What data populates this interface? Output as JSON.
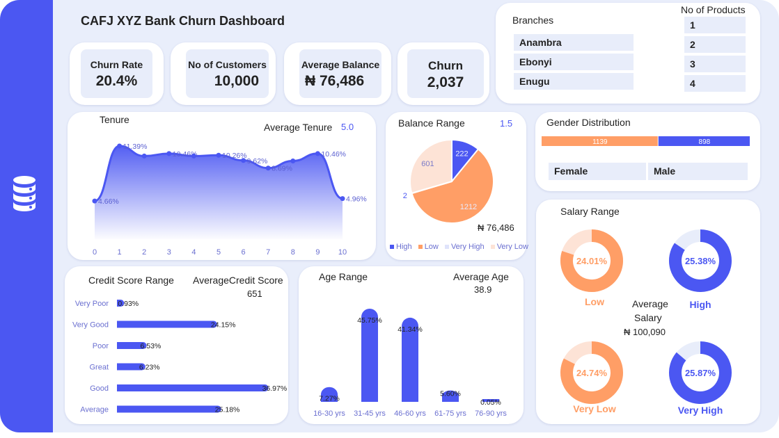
{
  "dashboard": {
    "title": "CAFJ XYZ Bank Churn Dashboard"
  },
  "kpis": [
    {
      "label": "Churn Rate",
      "value": "20.4%"
    },
    {
      "label": "No of Customers",
      "value": "10,000"
    },
    {
      "label": "Average Balance",
      "value": "₦ 76,486"
    },
    {
      "label": "Churn",
      "value": "2,037"
    }
  ],
  "branches": {
    "title": "Branches",
    "items": [
      "Anambra",
      "Ebonyi",
      "Enugu"
    ]
  },
  "products": {
    "title": "No of Products",
    "items": [
      "1",
      "2",
      "3",
      "4"
    ]
  },
  "tenure": {
    "title": "Tenure",
    "avg_label": "Average Tenure",
    "avg_value": "5.0"
  },
  "balance_range": {
    "title": "Balance Range",
    "value_note": "1.5",
    "avg_value": "₦ 76,486"
  },
  "gender": {
    "title": "Gender Distribution",
    "female_label": "Female",
    "male_label": "Male"
  },
  "credit": {
    "title": "Credit Score Range",
    "avg_label": "AverageCredit Score",
    "avg_value": "651"
  },
  "age": {
    "title": "Age Range",
    "avg_label": "Average Age",
    "avg_value": "38.9"
  },
  "salary": {
    "title": "Salary Range",
    "avg_label_1": "Average",
    "avg_label_2": "Salary",
    "avg_value": "₦ 100,090",
    "rings": [
      {
        "label": "Low",
        "value": 24.01,
        "text": "24.01%",
        "color": "#ff9e66"
      },
      {
        "label": "High",
        "value": 25.38,
        "text": "25.38%",
        "color": "#4b57f2"
      },
      {
        "label": "Very Low",
        "value": 24.74,
        "text": "24.74%",
        "color": "#ff9e66"
      },
      {
        "label": "Very High",
        "value": 25.87,
        "text": "25.87%",
        "color": "#4b57f2"
      }
    ]
  },
  "colors": {
    "accent": "#4b57f2",
    "orange": "#ff9e66",
    "peach": "#fde3d6",
    "pale_blue": "#e8edfa"
  },
  "chart_data": [
    {
      "type": "area",
      "id": "tenure",
      "x": [
        0,
        1,
        2,
        3,
        4,
        5,
        6,
        7,
        8,
        9,
        10
      ],
      "values": [
        4.66,
        11.39,
        10.16,
        10.46,
        10.16,
        10.26,
        9.62,
        8.69,
        9.56,
        10.46,
        4.96
      ],
      "labels": [
        "4.66%",
        "11.39%",
        "",
        "10.46%",
        "",
        "10.26%",
        "9.62%",
        "8.69%",
        "",
        "10.46%",
        "4.96%"
      ],
      "ylim": [
        0,
        13
      ]
    },
    {
      "type": "pie",
      "id": "balance_range",
      "categories": [
        "High",
        "Low",
        "Very High",
        "Very Low"
      ],
      "values": [
        222,
        1212,
        2,
        601
      ],
      "colors": [
        "#4b57f2",
        "#ff9e66",
        "#dfe3fb",
        "#fde3d6"
      ]
    },
    {
      "type": "bar",
      "id": "gender",
      "categories": [
        "Female",
        "Male"
      ],
      "values": [
        1139,
        898
      ],
      "colors": [
        "#ff9e66",
        "#4b57f2"
      ]
    },
    {
      "type": "bar",
      "id": "credit_score",
      "orientation": "horizontal",
      "categories": [
        "Very Poor",
        "Very Good",
        "Poor",
        "Great",
        "Good",
        "Average"
      ],
      "values": [
        0.93,
        24.15,
        6.53,
        6.23,
        36.97,
        25.18
      ],
      "labels": [
        "0.93%",
        "24.15%",
        "6.53%",
        "6.23%",
        "36.97%",
        "25.18%"
      ]
    },
    {
      "type": "bar",
      "id": "age",
      "categories": [
        "16-30 yrs",
        "31-45 yrs",
        "46-60 yrs",
        "61-75 yrs",
        "76-90 yrs"
      ],
      "values": [
        7.27,
        45.75,
        41.34,
        5.6,
        0.05
      ],
      "labels": [
        "7.27%",
        "45.75%",
        "41.34%",
        "5.60%",
        "0.05%"
      ]
    }
  ]
}
